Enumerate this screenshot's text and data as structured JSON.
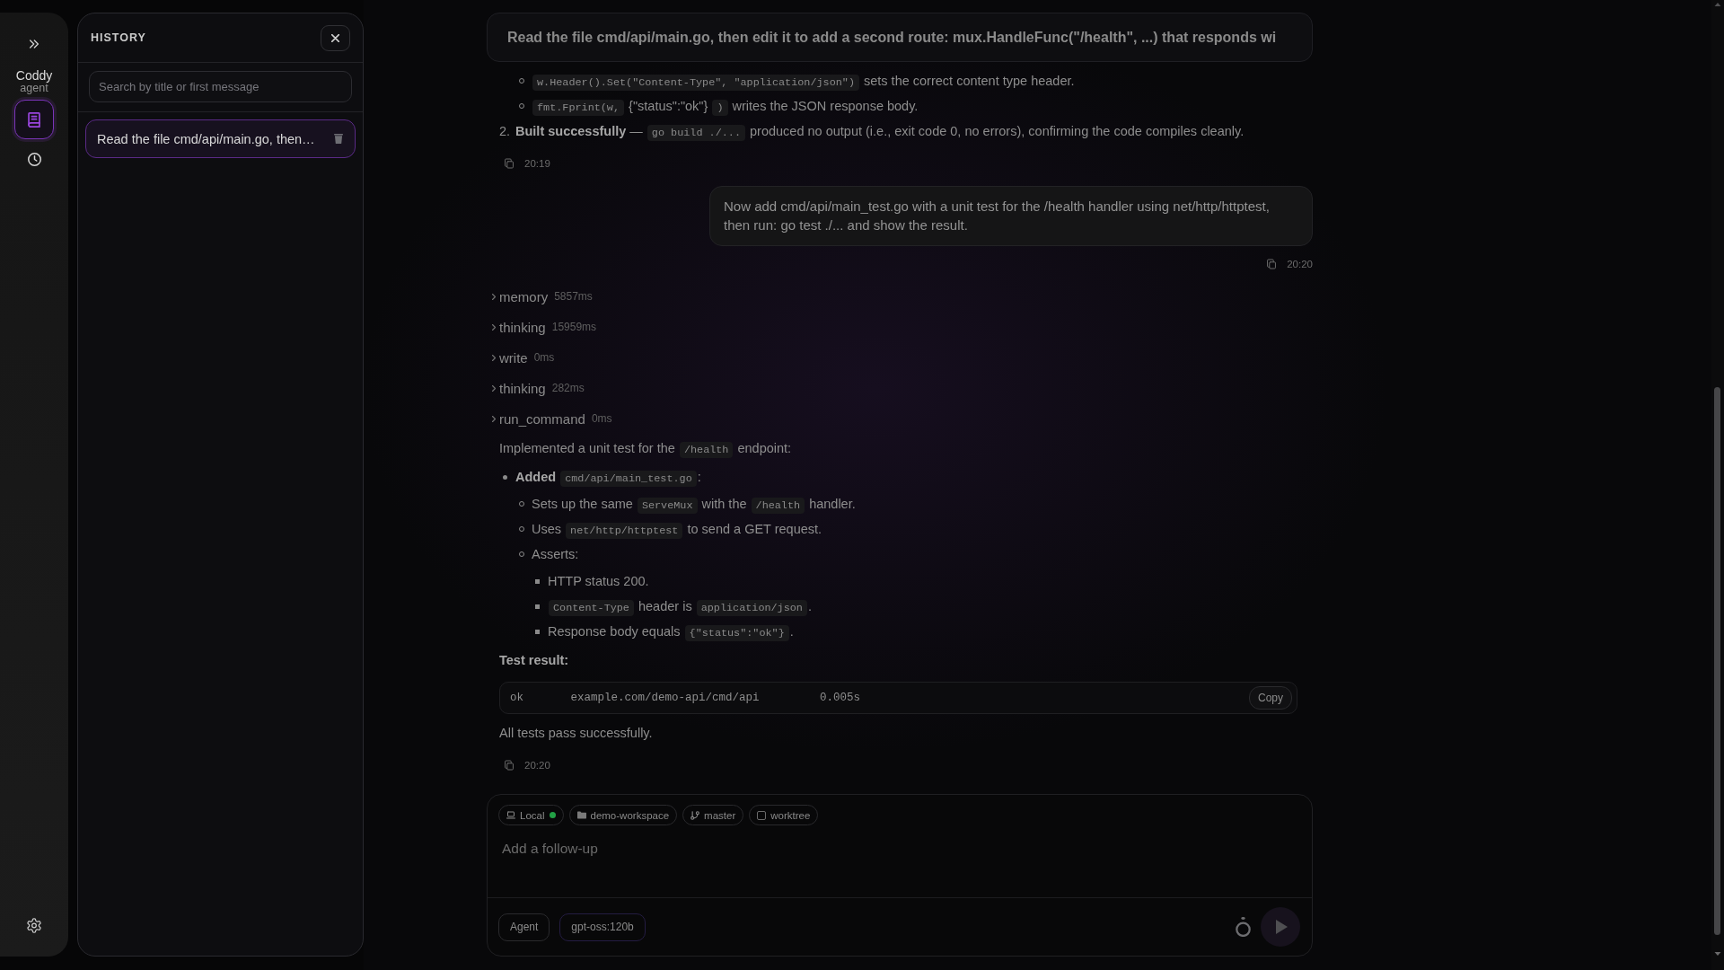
{
  "rail": {
    "app_name": "Coddy",
    "app_subtitle": "agent",
    "nav": [
      {
        "selected": true
      },
      {
        "selected": false
      }
    ]
  },
  "history": {
    "title": "HISTORY",
    "search": {
      "placeholder": "Search by title or first message"
    },
    "items": [
      {
        "title": "Read the file cmd/api/main.go, then…",
        "selected": true
      }
    ]
  },
  "chat": {
    "pinned_prompt": "Read the file cmd/api/main.go, then edit it to add a second route: mux.HandleFunc(\"/health\", ...) that responds wi",
    "messages": [
      {
        "kind": "assistant",
        "blocks": [
          {
            "kind": "list",
            "items": [
              {
                "children": [
                  {
                    "segments": [
                      {
                        "kind": "code",
                        "text": "w.Header().Set(\"Content-Type\", \"application/json\")"
                      },
                      {
                        "kind": "text",
                        "text": " sets the correct content type header."
                      }
                    ]
                  },
                  {
                    "segments": [
                      {
                        "kind": "code",
                        "text": "fmt.Fprint(w,"
                      },
                      {
                        "kind": "text",
                        "text": " {\"status\":\"ok\"} "
                      },
                      {
                        "kind": "code",
                        "text": ")"
                      },
                      {
                        "kind": "text",
                        "text": " writes the JSON response body."
                      }
                    ]
                  }
                ]
              },
              {
                "marker": "2.",
                "segments": [
                  {
                    "kind": "text",
                    "text": "**Built successfully** — "
                  },
                  {
                    "kind": "code",
                    "text": "go build ./..."
                  },
                  {
                    "kind": "text",
                    "text": " produced no output (i.e., exit code 0, no errors), confirming the code compiles cleanly."
                  }
                ]
              }
            ]
          }
        ],
        "time": "20:19"
      },
      {
        "kind": "user",
        "text": "Now add cmd/api/main_test.go with a unit test for the /health handler using net/http/httptest, then run: go test ./... and show the result.",
        "time": "20:20"
      },
      {
        "kind": "assistant",
        "steps": [
          {
            "name": "memory",
            "duration": "5857ms",
            "expanded": false
          },
          {
            "name": "thinking",
            "duration": "15959ms",
            "expanded": false
          },
          {
            "name": "write",
            "duration": "0ms",
            "expanded": false
          },
          {
            "name": "thinking",
            "duration": "282ms",
            "expanded": false
          },
          {
            "name": "run_command",
            "duration": "0ms",
            "expanded": false
          }
        ],
        "blocks": [
          {
            "kind": "para",
            "segments": [
              {
                "kind": "text",
                "text": "Implemented a unit test for the "
              },
              {
                "kind": "code",
                "text": "/health"
              },
              {
                "kind": "text",
                "text": " endpoint:"
              }
            ]
          },
          {
            "kind": "list",
            "items": [
              {
                "segments": [
                  {
                    "kind": "text",
                    "text": "**Added** "
                  },
                  {
                    "kind": "code",
                    "text": "cmd/api/main_test.go"
                  },
                  {
                    "kind": "text",
                    "text": ":"
                  }
                ],
                "children": [
                  {
                    "segments": [
                      {
                        "kind": "text",
                        "text": "Sets up the same "
                      },
                      {
                        "kind": "code",
                        "text": "ServeMux"
                      },
                      {
                        "kind": "text",
                        "text": " with the "
                      },
                      {
                        "kind": "code",
                        "text": "/health"
                      },
                      {
                        "kind": "text",
                        "text": " handler."
                      }
                    ]
                  },
                  {
                    "segments": [
                      {
                        "kind": "text",
                        "text": "Uses "
                      },
                      {
                        "kind": "code",
                        "text": "net/http/httptest"
                      },
                      {
                        "kind": "text",
                        "text": " to send a GET request."
                      }
                    ]
                  },
                  {
                    "segments": [
                      {
                        "kind": "text",
                        "text": "Asserts:"
                      }
                    ],
                    "children": [
                      {
                        "segments": [
                          {
                            "kind": "text",
                            "text": "HTTP status 200."
                          }
                        ]
                      },
                      {
                        "segments": [
                          {
                            "kind": "code",
                            "text": "Content-Type"
                          },
                          {
                            "kind": "text",
                            "text": " header is "
                          },
                          {
                            "kind": "code",
                            "text": "application/json"
                          },
                          {
                            "kind": "text",
                            "text": "."
                          }
                        ]
                      },
                      {
                        "segments": [
                          {
                            "kind": "text",
                            "text": "Response body equals "
                          },
                          {
                            "kind": "code",
                            "text": "{\"status\":\"ok\"}"
                          },
                          {
                            "kind": "text",
                            "text": "."
                          }
                        ]
                      }
                    ]
                  }
                ]
              }
            ]
          },
          {
            "kind": "heading",
            "text": "Test result:"
          },
          {
            "kind": "code_block",
            "text": "ok       example.com/demo-api/cmd/api         0.005s",
            "copy_label": "Copy"
          },
          {
            "kind": "para",
            "segments": [
              {
                "kind": "text",
                "text": "All tests pass successfully."
              }
            ]
          }
        ],
        "time": "20:20"
      }
    ]
  },
  "composer": {
    "chips": [
      {
        "kind": "environment",
        "label": "Local",
        "color": "#22a045"
      },
      {
        "kind": "workspace",
        "label": "demo-workspace"
      },
      {
        "kind": "branch",
        "label": "master"
      },
      {
        "kind": "toggle",
        "label": "worktree",
        "checked": false
      }
    ],
    "placeholder": "Add a follow-up",
    "mode": "Agent",
    "model": "gpt-oss:120b",
    "send": {
      "disabled": true
    }
  }
}
